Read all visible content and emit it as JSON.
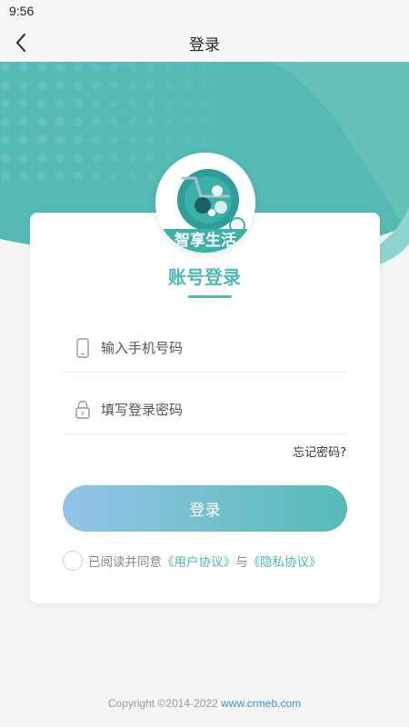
{
  "status_bar": {
    "time": "9:56"
  },
  "nav": {
    "title": "登录",
    "back_icon": "chevron-left-icon"
  },
  "form": {
    "heading": "账号登录",
    "logo_text": "智享生活",
    "phone_placeholder": "输入手机号码",
    "phone_icon": "smartphone-icon",
    "password_placeholder": "填写登录密码",
    "password_icon": "lock-icon",
    "forgot_label": "忘记密码?",
    "login_label": "登录"
  },
  "agreement": {
    "prefix": "已阅读并同意",
    "user_agreement": "《用户协议》",
    "conjunction": "与",
    "privacy_agreement": "《隐私协议》",
    "checked": false
  },
  "footer": {
    "copyright": "Copyright ©2014-2022",
    "site": "www.crmeb.com"
  },
  "colors": {
    "accent": "#4fb8b1",
    "button_start": "#93c4e8",
    "button_end": "#57bbb5",
    "link": "#3b8fd8"
  }
}
